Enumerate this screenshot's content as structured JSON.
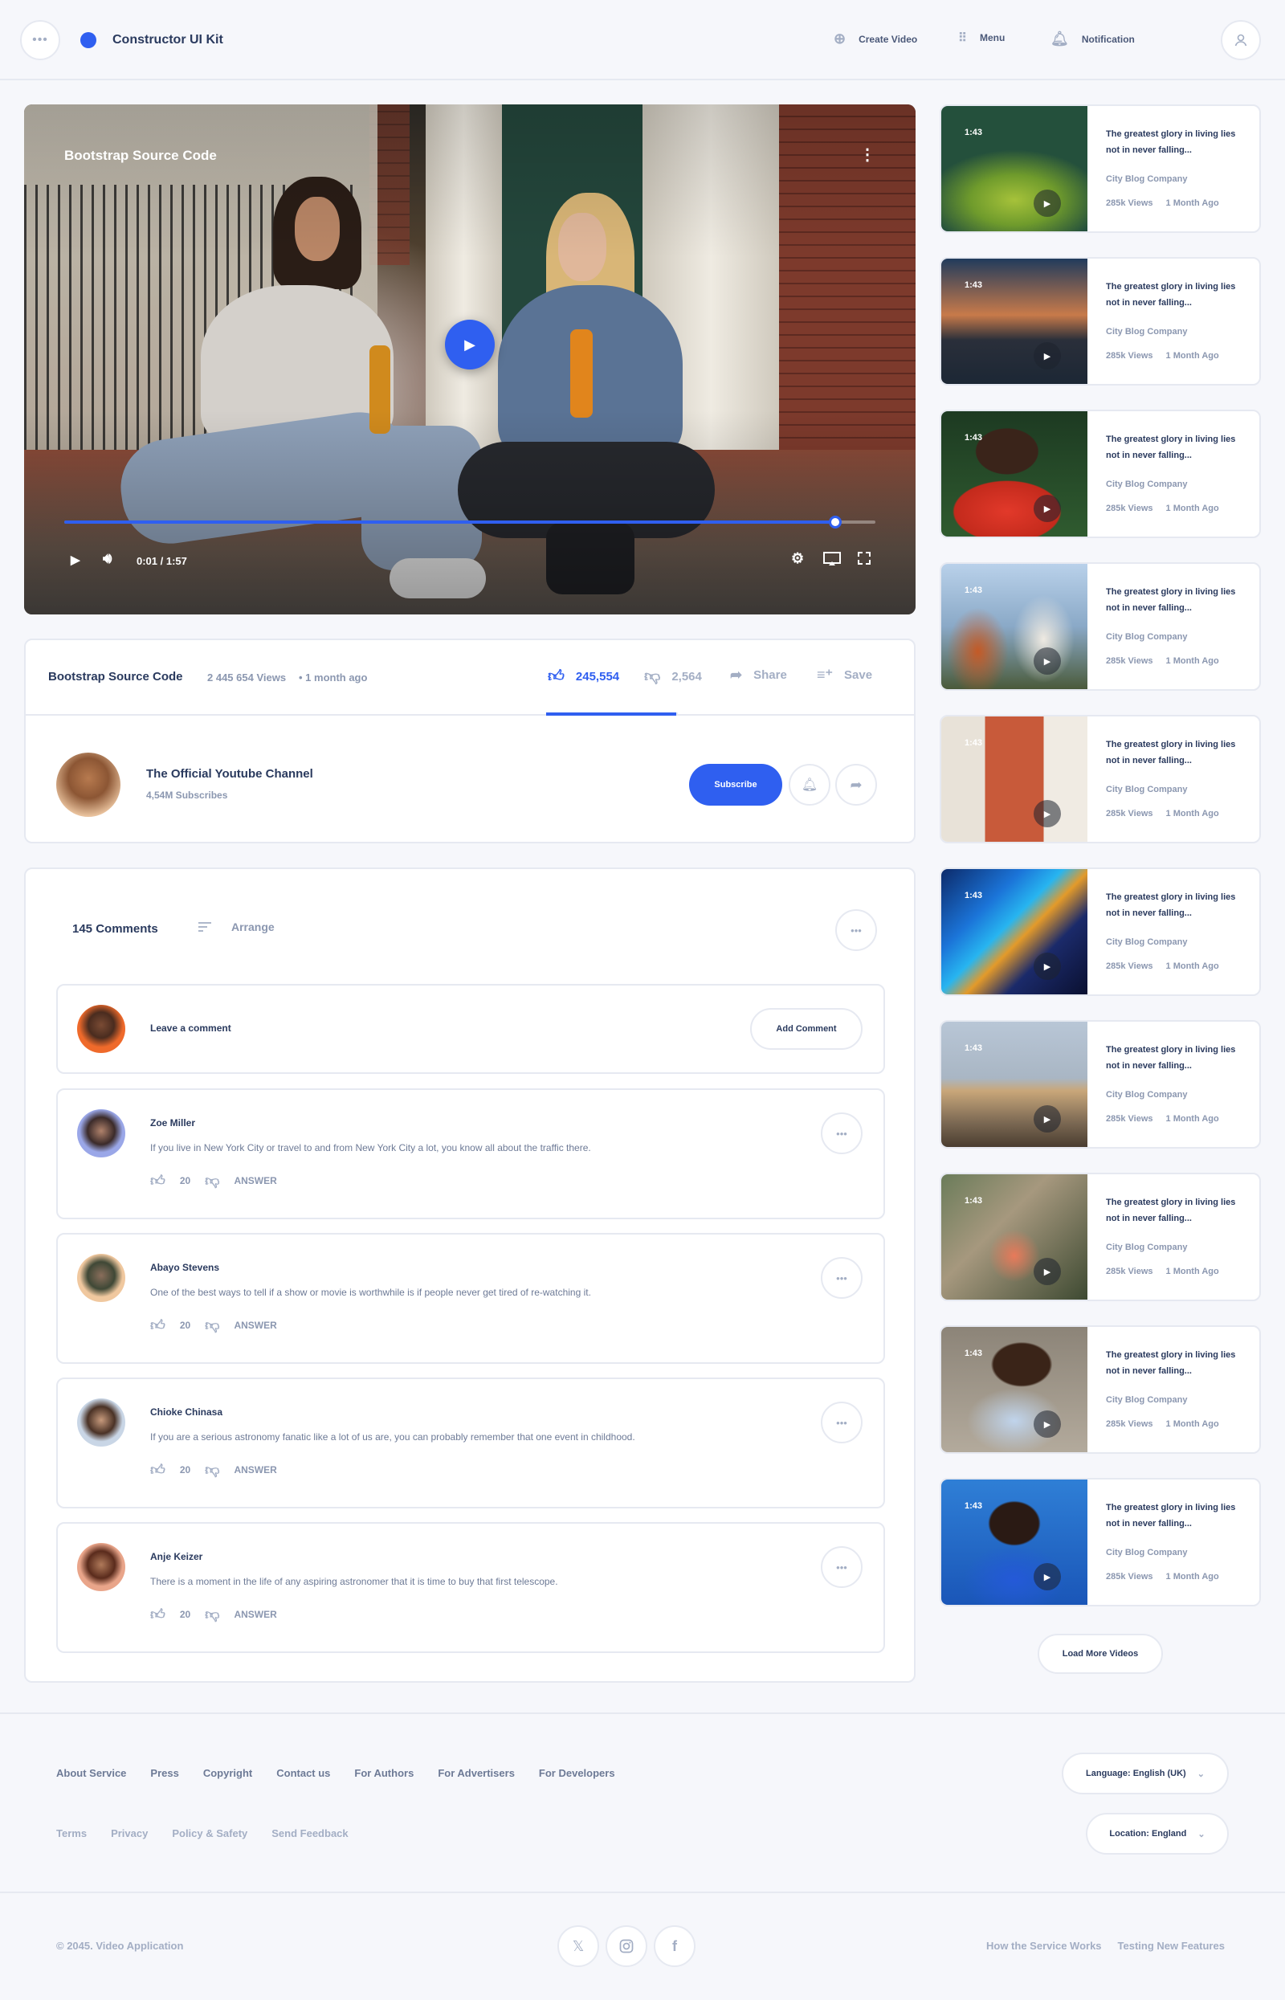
{
  "colors": {
    "accent": "#2f5ff0",
    "text": "#2a3a5e",
    "muted": "#a3aec4",
    "border": "#e6e9f1",
    "background": "#f6f7fb"
  },
  "header": {
    "brand": "Constructor UI Kit",
    "menu_icon": "dots-icon",
    "links": [
      {
        "label": "Create Video",
        "icon": "plus-circle-icon"
      },
      {
        "label": "Menu",
        "icon": "grid-icon"
      },
      {
        "label": "Notification",
        "icon": "bell-icon"
      }
    ],
    "profile_icon": "user-icon"
  },
  "player": {
    "title": "Bootstrap Source Code",
    "time": "0:01 / 1:57",
    "progress": 0.95
  },
  "video_info": {
    "title": "Bootstrap Source Code",
    "views": "2 445 654 Views",
    "date": "• 1 month ago",
    "likes": "245,554",
    "dislikes": "2,564",
    "share_label": "Share",
    "save_label": "Save",
    "like_ratio": 0.99
  },
  "channel": {
    "name": "The Official Youtube Channel",
    "subscribers": "4,54M Subscribes",
    "subscribe_label": "Subscribe"
  },
  "comments": {
    "count_label": "145 Comments",
    "arrange_label": "Arrange",
    "leave_label": "Leave a comment",
    "add_label": "Add Comment",
    "items": [
      {
        "name": "Zoe Miller",
        "text": "If you live in New York City or travel to and from New York City a lot, you know all about the traffic there.",
        "likes": "20",
        "answer": "ANSWER"
      },
      {
        "name": "Abayo Stevens",
        "text": "One of the best ways to tell if a show or movie is worthwhile is if people never get tired of re-watching it.",
        "likes": "20",
        "answer": "ANSWER"
      },
      {
        "name": "Chioke Chinasa",
        "text": "If you are a serious astronomy fanatic like a lot of us are, you can probably remember that one event in childhood.",
        "likes": "20",
        "answer": "ANSWER"
      },
      {
        "name": "Anje Keizer",
        "text": "There is a moment in the life of any aspiring astronomer that it is time to buy that first telescope.",
        "likes": "20",
        "answer": "ANSWER"
      }
    ]
  },
  "related": {
    "items": [
      {
        "duration": "1:43",
        "title": "The greatest glory in living lies not in never falling...",
        "channel": "City Blog Company",
        "views": "285k Views",
        "age": "1 Month Ago"
      },
      {
        "duration": "1:43",
        "title": "The greatest glory in living lies not in never falling...",
        "channel": "City Blog Company",
        "views": "285k Views",
        "age": "1 Month Ago"
      },
      {
        "duration": "1:43",
        "title": "The greatest glory in living lies not in never falling...",
        "channel": "City Blog Company",
        "views": "285k Views",
        "age": "1 Month Ago"
      },
      {
        "duration": "1:43",
        "title": "The greatest glory in living lies not in never falling...",
        "channel": "City Blog Company",
        "views": "285k Views",
        "age": "1 Month Ago"
      },
      {
        "duration": "1:43",
        "title": "The greatest glory in living lies not in never falling...",
        "channel": "City Blog Company",
        "views": "285k Views",
        "age": "1 Month Ago"
      },
      {
        "duration": "1:43",
        "title": "The greatest glory in living lies not in never falling...",
        "channel": "City Blog Company",
        "views": "285k Views",
        "age": "1 Month Ago"
      },
      {
        "duration": "1:43",
        "title": "The greatest glory in living lies not in never falling...",
        "channel": "City Blog Company",
        "views": "285k Views",
        "age": "1 Month Ago"
      },
      {
        "duration": "1:43",
        "title": "The greatest glory in living lies not in never falling...",
        "channel": "City Blog Company",
        "views": "285k Views",
        "age": "1 Month Ago"
      },
      {
        "duration": "1:43",
        "title": "The greatest glory in living lies not in never falling...",
        "channel": "City Blog Company",
        "views": "285k Views",
        "age": "1 Month Ago"
      },
      {
        "duration": "1:43",
        "title": "The greatest glory in living lies not in never falling...",
        "channel": "City Blog Company",
        "views": "285k Views",
        "age": "1 Month Ago"
      }
    ],
    "load_more_label": "Load More Videos"
  },
  "footer": {
    "links_row1": [
      "About Service",
      "Press",
      "Copyright",
      "Contact us",
      "For Authors",
      "For Advertisers",
      "For Developers"
    ],
    "links_row2": [
      "Terms",
      "Privacy",
      "Policy & Safety",
      "Send Feedback"
    ],
    "language": "Language: English (UK)",
    "location": "Location: England",
    "copyright": "© 2045. Video Application",
    "social_icons": [
      "x-icon",
      "instagram-icon",
      "facebook-icon"
    ],
    "bottom_links": [
      "How the Service Works",
      "Testing New Features"
    ]
  }
}
